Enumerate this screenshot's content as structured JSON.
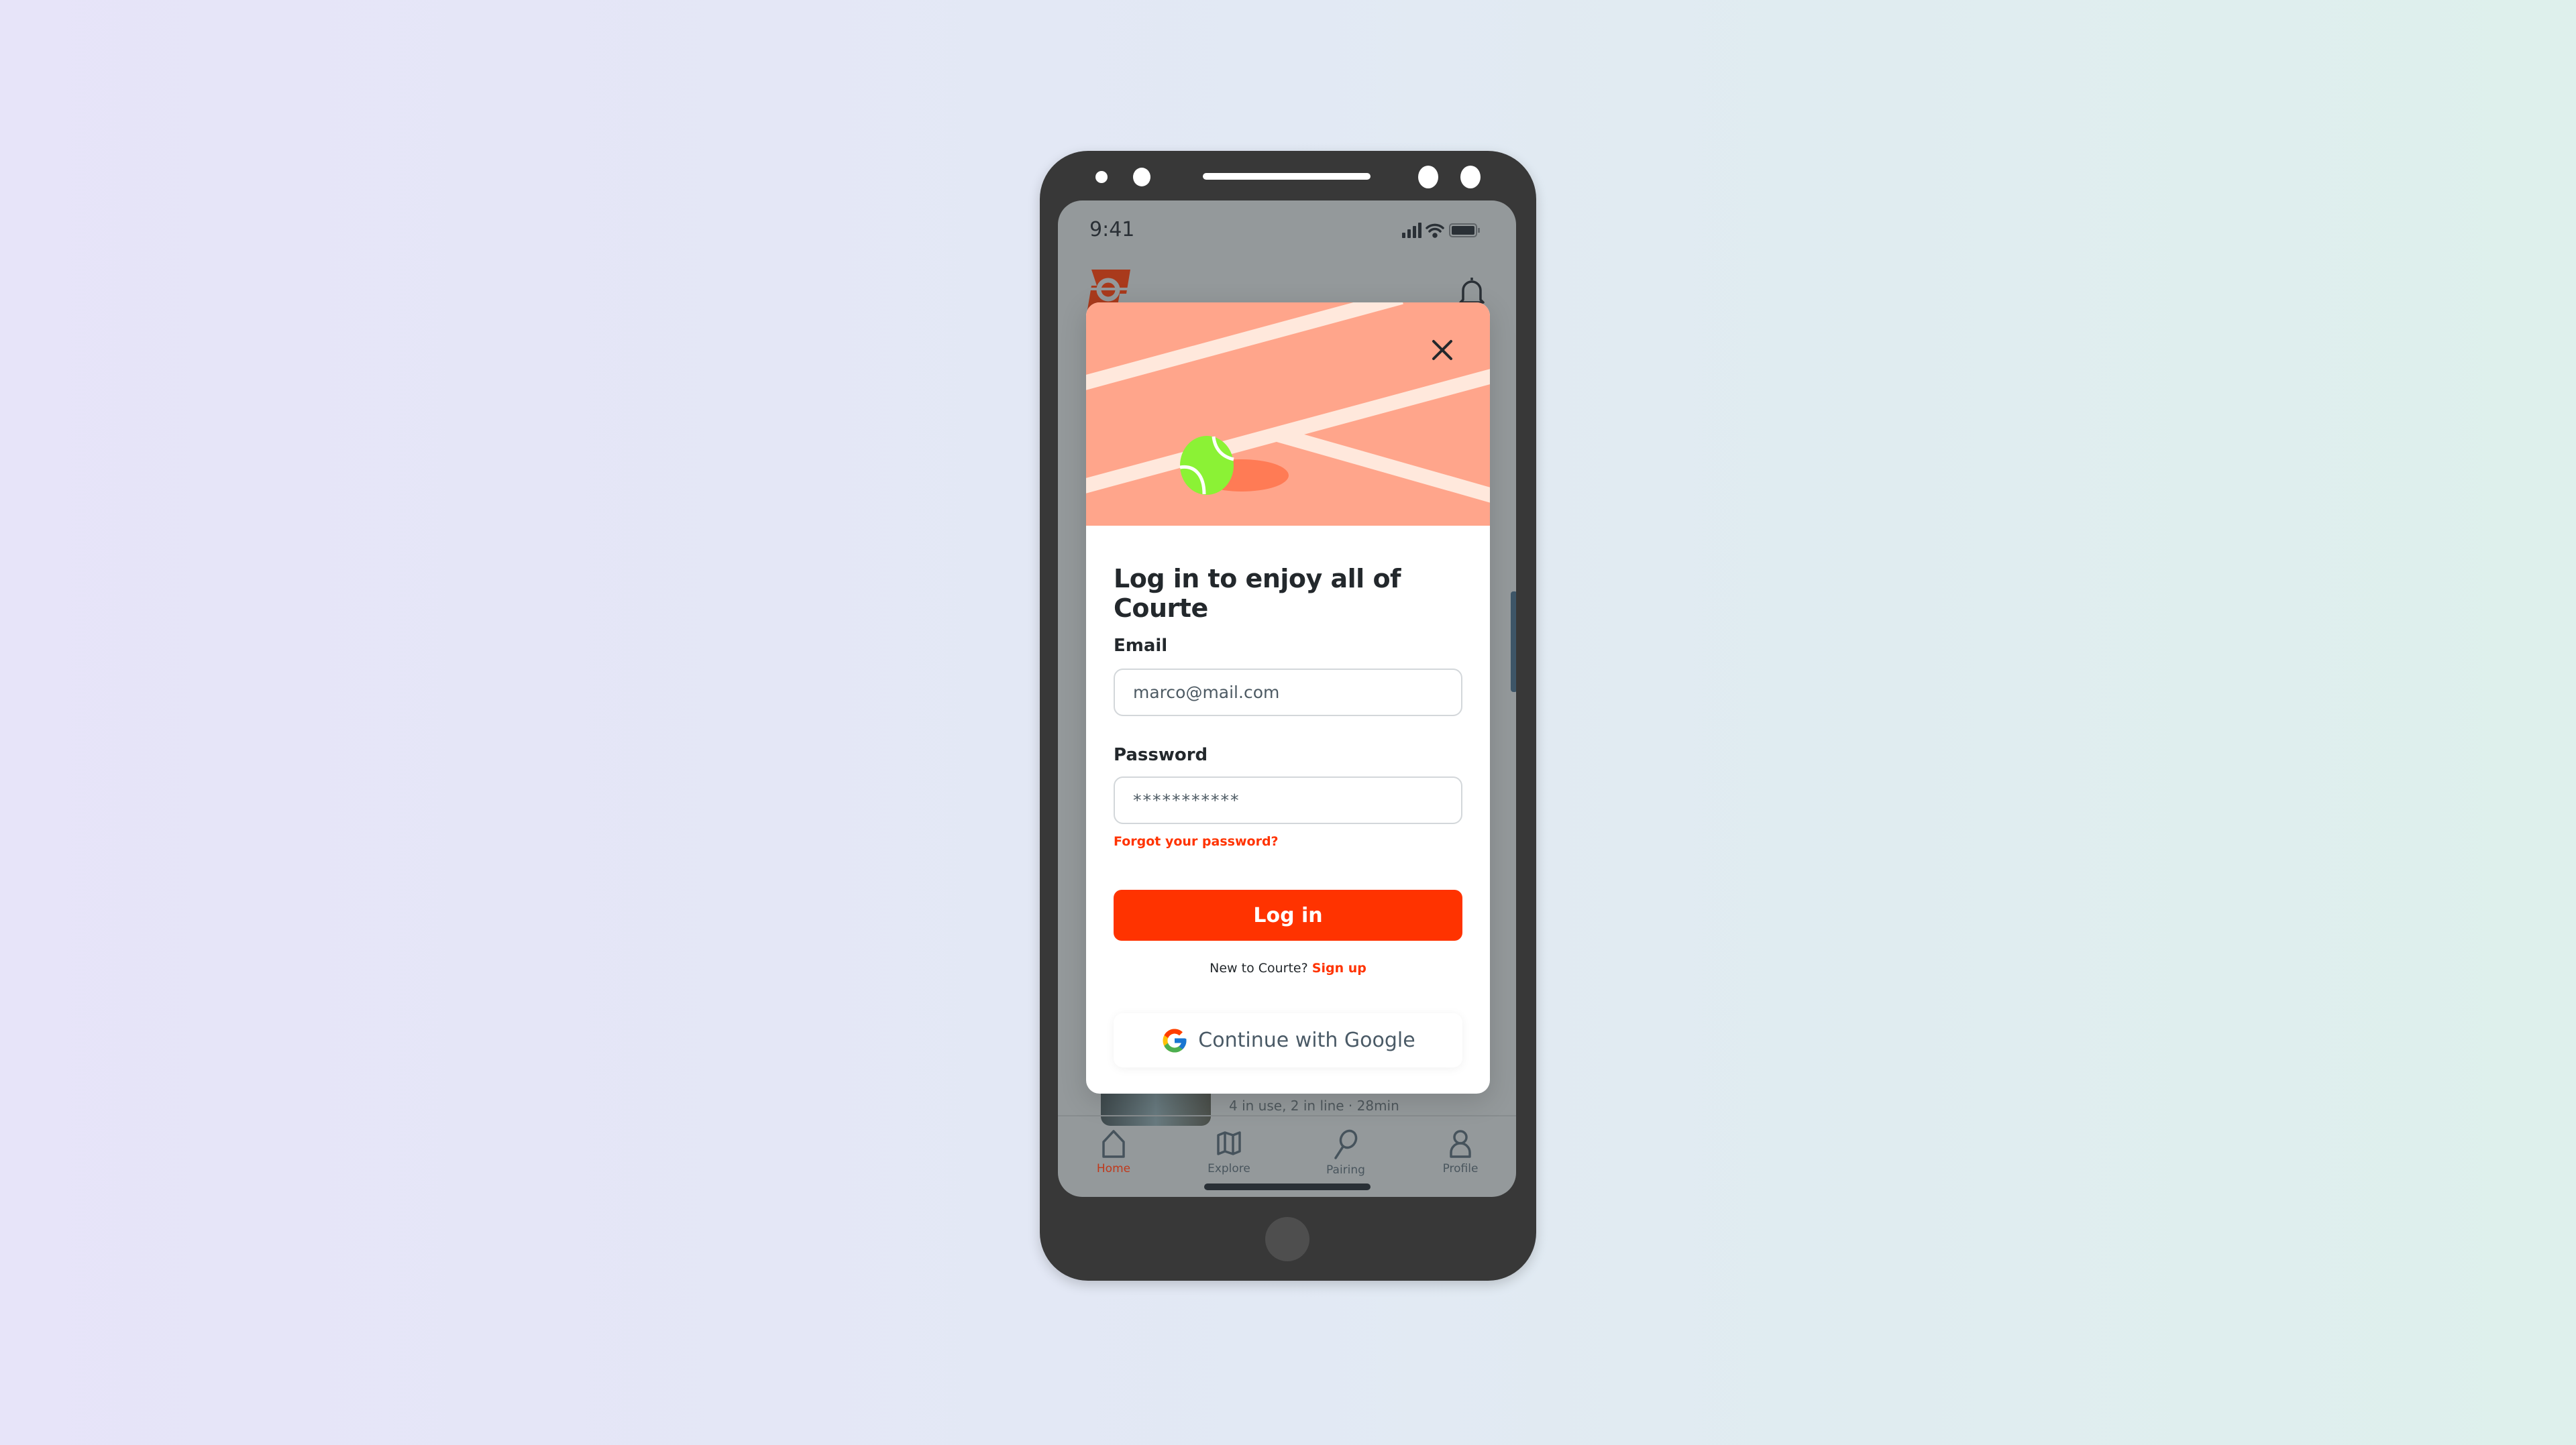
{
  "status_bar": {
    "time": "9:41",
    "icons": [
      "signal-icon",
      "wifi-icon",
      "battery-icon"
    ]
  },
  "app_header": {
    "logo": "courte-logo",
    "notification_icon": "bell-icon"
  },
  "background_list": {
    "visible_item_meta": "4 in use, 2 in line · 28min"
  },
  "tab_bar": {
    "active_color": "#c0391b",
    "items": [
      {
        "label": "Home",
        "icon": "home-icon",
        "active": true
      },
      {
        "label": "Explore",
        "icon": "map-icon",
        "active": false
      },
      {
        "label": "Pairing",
        "icon": "racket-icon",
        "active": false
      },
      {
        "label": "Profile",
        "icon": "user-icon",
        "active": false
      }
    ]
  },
  "modal": {
    "close_icon": "close-icon",
    "title": "Log in to enjoy all of Courte",
    "email": {
      "label": "Email",
      "value": "marco@mail.com"
    },
    "password": {
      "label": "Password",
      "value": "***********"
    },
    "forgot_password": "Forgot your password?",
    "login_button": "Log in",
    "signup_prompt": "New to Courte?",
    "signup_link": "Sign up",
    "google_button": "Continue with Google"
  },
  "colors": {
    "accent": "#ff3300",
    "banner": "#ffa58b",
    "court_lines": "#ffe8dc",
    "ball": "#8bf235"
  }
}
